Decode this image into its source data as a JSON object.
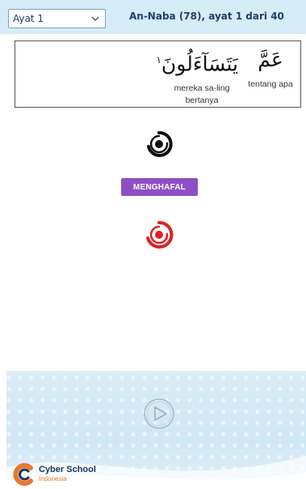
{
  "header": {
    "select_value": "Ayat 1",
    "title": "An-Naba (78), ayat 1 dari 40"
  },
  "verse": {
    "words": [
      {
        "arabic": "عَمَّ",
        "translation": "tentang apa"
      },
      {
        "arabic": "يَتَسَآءَلُونَ",
        "translation": "mereka sa-ling bertanya"
      }
    ],
    "ayah_end_mark": "١"
  },
  "controls": {
    "record_icon": "record-icon",
    "menghafal_label": "MENGHAFAL",
    "record_active_icon": "record-active-icon",
    "play_icon": "play-icon"
  },
  "brand": {
    "name": "Cyber School",
    "sub": "Indonesia",
    "colors": {
      "orange": "#e8772e",
      "navy": "#1d3557",
      "purple": "#8e4fc4",
      "red": "#e02020"
    }
  }
}
